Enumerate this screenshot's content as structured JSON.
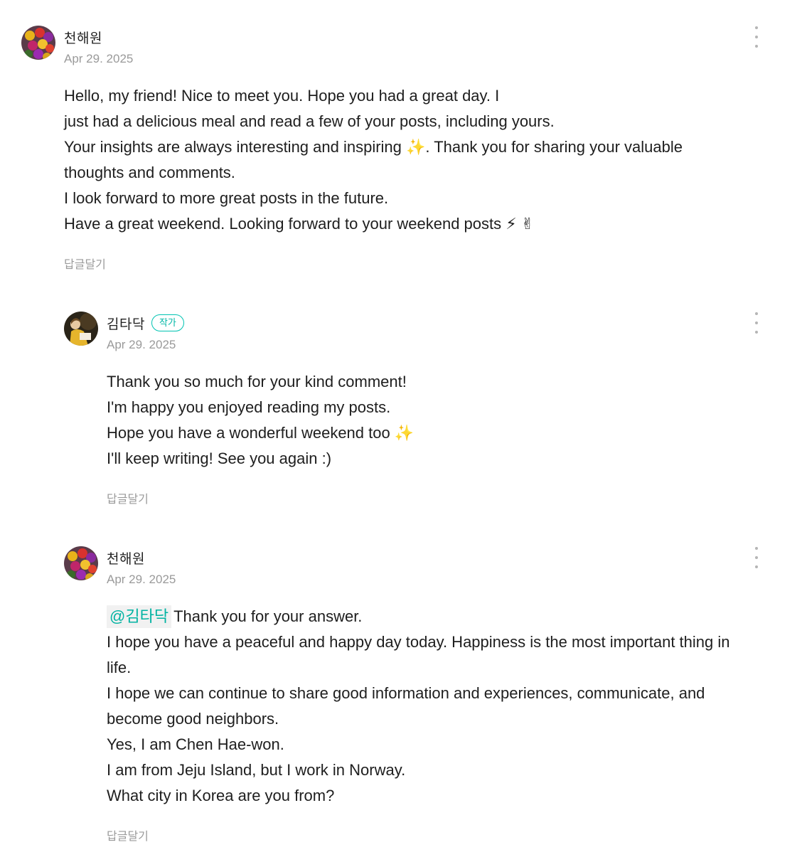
{
  "comments": [
    {
      "author": "천해원",
      "date": "Apr 29. 2025",
      "avatar_icon": "flower-bouquet-avatar",
      "lines": [
        "Hello, my friend! Nice to meet you. Hope you had a great day. I",
        "just had a delicious meal and read a few of your posts, including yours.",
        "Your insights are always interesting and inspiring ✨. Thank you for sharing your valuable",
        "thoughts and comments.",
        "I look forward to more great posts in the future.",
        "Have a great weekend. Looking forward to your weekend posts ⚡ ✌"
      ],
      "reply_label": "답글달기"
    },
    {
      "author": "김타닥",
      "badge": "작가",
      "date": "Apr 29. 2025",
      "avatar_icon": "reading-person-avatar",
      "lines": [
        "Thank you so much for your kind comment!",
        "I'm happy you enjoyed reading my posts.",
        "Hope you have a wonderful weekend too ✨",
        "I'll keep writing! See you again :)"
      ],
      "reply_label": "답글달기"
    },
    {
      "author": "천해원",
      "date": "Apr 29. 2025",
      "avatar_icon": "flower-bouquet-avatar",
      "mention": "@김타닥",
      "first_line": "Thank you for your answer.",
      "lines": [
        "I hope you have a peaceful and happy day today. Happiness is the most important thing in",
        "life.",
        "I hope we can continue to share good information and experiences, communicate, and",
        "become good neighbors.",
        "Yes, I am Chen Hae-won.",
        "I am from Jeju Island, but I work in Norway.",
        "What city in Korea are you from?"
      ],
      "reply_label": "답글달기"
    }
  ],
  "colors": {
    "accent": "#00b7a6",
    "muted": "#9a9a9a",
    "text": "#1e1e1e"
  }
}
